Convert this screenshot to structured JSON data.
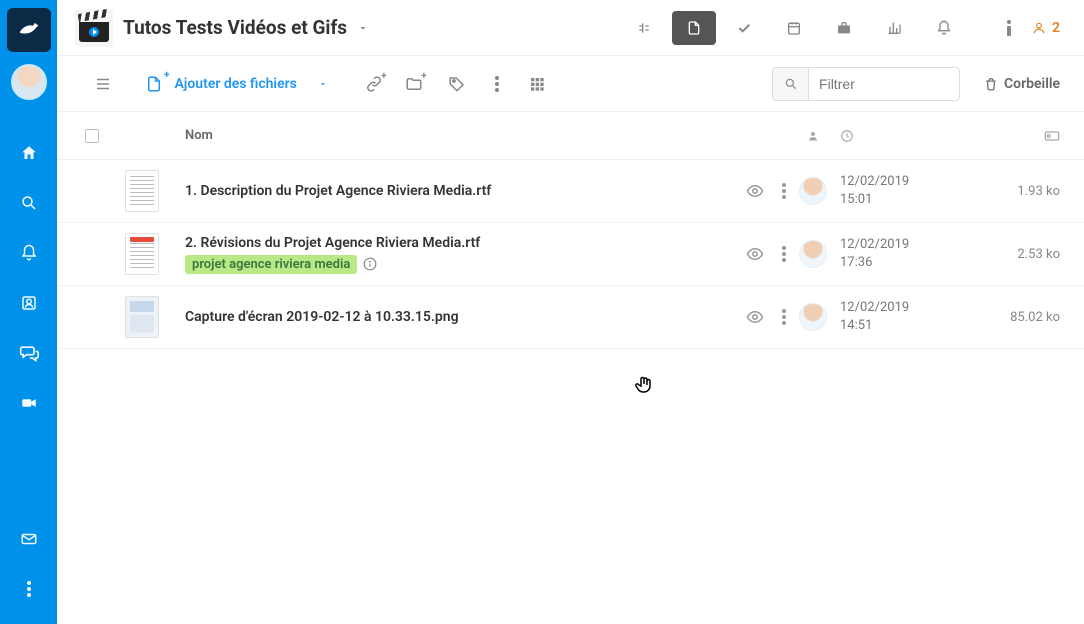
{
  "project": {
    "title": "Tutos Tests Vidéos et Gifs"
  },
  "header": {
    "members_count": "2"
  },
  "toolbar": {
    "add_files_label": "Ajouter des fichiers",
    "filter_placeholder": "Filtrer",
    "trash_label": "Corbeille"
  },
  "columns": {
    "name": "Nom"
  },
  "files": [
    {
      "name": "1. Description du Projet Agence Riviera Media.rtf",
      "date": "12/02/2019 15:01",
      "size": "1.93 ko",
      "thumb": "doc"
    },
    {
      "name": "2. Révisions du Projet Agence Riviera Media.rtf",
      "tag": "projet agence riviera media",
      "date": "12/02/2019 17:36",
      "size": "2.53 ko",
      "thumb": "doc-red",
      "has_info": true
    },
    {
      "name": "Capture d'écran 2019-02-12 à 10.33.15.png",
      "date": "12/02/2019 14:51",
      "size": "85.02 ko",
      "thumb": "img"
    }
  ]
}
